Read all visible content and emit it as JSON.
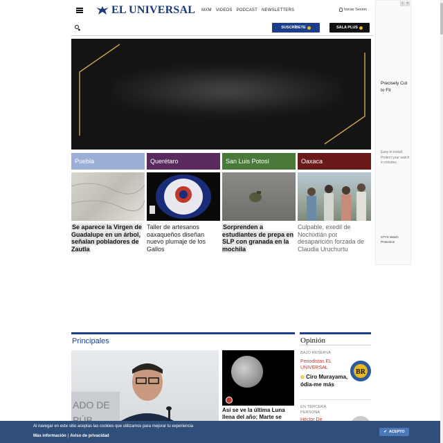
{
  "header": {
    "logo_text": "EL UNIVERSAL",
    "nav": [
      "MXM",
      "VIDEOS",
      "PODCAST",
      "NEWSLETTERS"
    ],
    "login_label": "Iniciar Sesion"
  },
  "actions": {
    "subscribe_label": "SUSCRÍBETE",
    "sala_plus_label": "SALA PLUS"
  },
  "ad": {
    "title": "Precisely Cut to Fit",
    "body": "Easy to install, Protect your watch in minutes.",
    "brand": "STYX Watch Protection"
  },
  "regions": [
    {
      "label": "Puebla",
      "color": "#9aaed6",
      "headline": "Se aparece la Virgen de Guadalupe en un árbol, señalan pobladores de Zautla",
      "style": "strong"
    },
    {
      "label": "Querétaro",
      "color": "#5a2a5e",
      "headline": "Taller de artesanos oaxaqueños diseñan nuevo plumaje de los Gallos",
      "style": "normal"
    },
    {
      "label": "San Luis Potosí",
      "color": "#4a7a3a",
      "headline": "Sorprenden a estudiantes de prepa en SLP con granada en la mochila",
      "style": "strong"
    },
    {
      "label": "Oaxaca",
      "color": "#6b1a1a",
      "headline": "Culpable, exedil de Nochixtlán por desaparición forzada de Claudia Uruchurtu",
      "style": "gray"
    }
  ],
  "principales": {
    "title": "Principales",
    "moon_headline": "Así se ve la última Luna llena del año; Marte se"
  },
  "opinion": {
    "title": "Opinión",
    "items": [
      {
        "section": "BAJO RESERVA",
        "author": "Periodistas EL UNIVERSAL",
        "headline": "Ciro Murayama, ódia-me más",
        "avatar": "BR"
      },
      {
        "section": "EN TERCERA PERSONA",
        "author": "Héctor De",
        "headline": "",
        "avatar": ""
      }
    ]
  },
  "cookie": {
    "text": "Al navegar en este sitio aceptas las cookies que utilizamos para mejorar tu experiencia",
    "more_info": "Más información",
    "privacy": "Aviso de privacidad",
    "accept_label": "ACEPTO"
  },
  "colors": {
    "brand": "#1c3e8a",
    "cookie_bg": "#2f4f7a",
    "accent_red": "#c0392b"
  }
}
